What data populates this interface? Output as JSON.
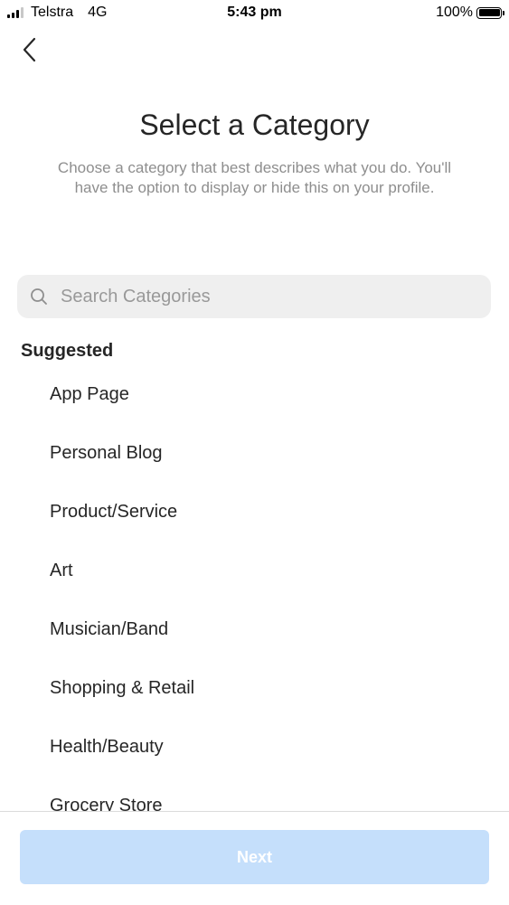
{
  "status_bar": {
    "carrier": "Telstra",
    "network": "4G",
    "time": "5:43 pm",
    "battery": "100%"
  },
  "header": {
    "back_icon": "chevron-left-icon",
    "title": "Select a Category",
    "subtitle": "Choose a category that best describes what you do. You'll have the option to display or hide this on your profile."
  },
  "search": {
    "icon": "search-icon",
    "placeholder": "Search Categories",
    "value": ""
  },
  "suggested": {
    "title": "Suggested",
    "items": [
      "App Page",
      "Personal Blog",
      "Product/Service",
      "Art",
      "Musician/Band",
      "Shopping & Retail",
      "Health/Beauty",
      "Grocery Store"
    ]
  },
  "footer": {
    "next_label": "Next",
    "next_color": "#c5dffb"
  }
}
